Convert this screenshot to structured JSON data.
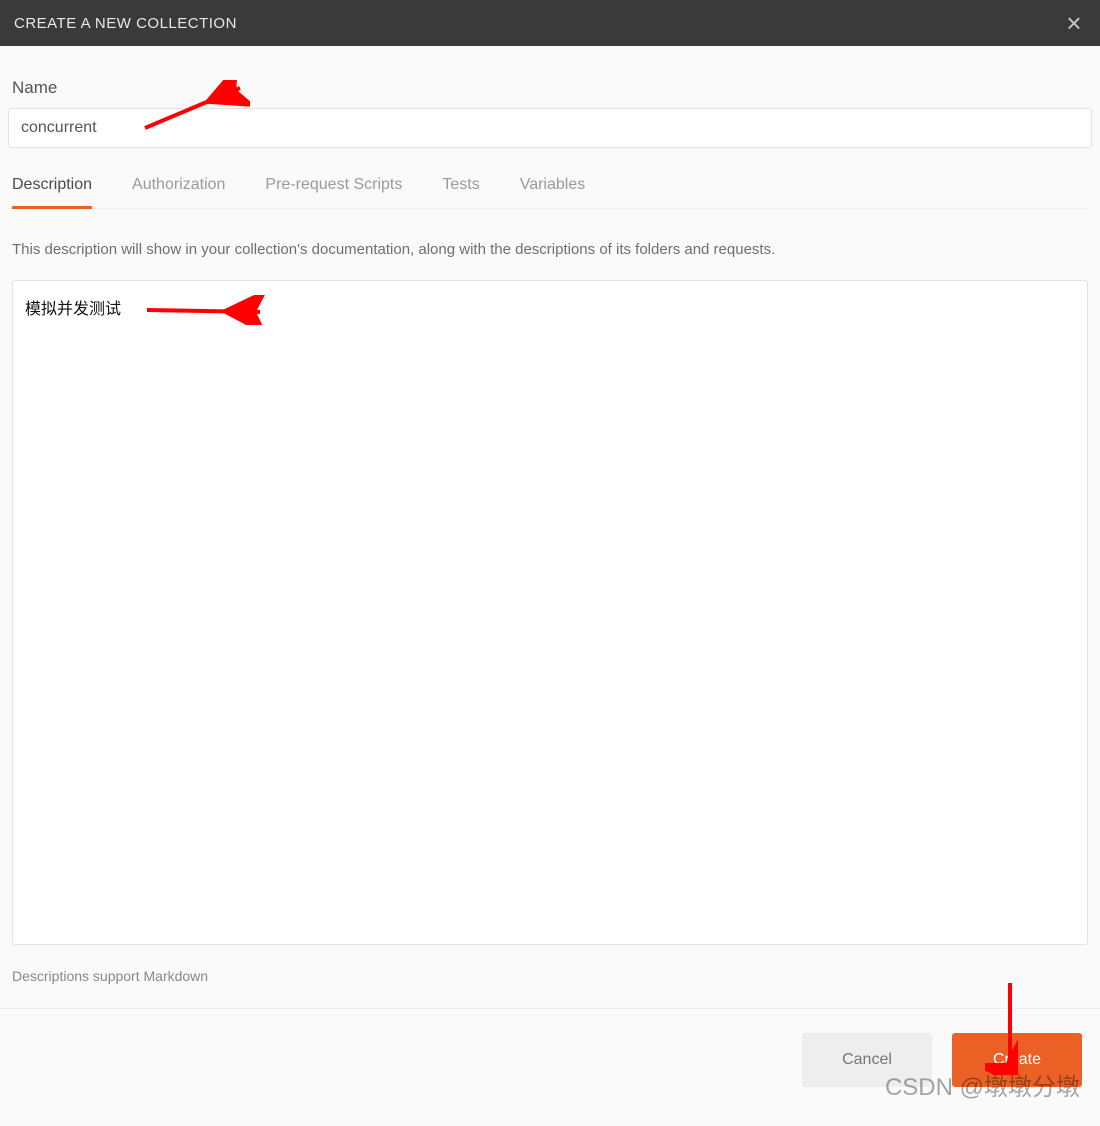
{
  "header": {
    "title": "CREATE A NEW COLLECTION"
  },
  "form": {
    "name_label": "Name",
    "name_value": "concurrent"
  },
  "tabs": {
    "items": [
      {
        "label": "Description",
        "active": true
      },
      {
        "label": "Authorization",
        "active": false
      },
      {
        "label": "Pre-request Scripts",
        "active": false
      },
      {
        "label": "Tests",
        "active": false
      },
      {
        "label": "Variables",
        "active": false
      }
    ],
    "description_hint": "This description will show in your collection's documentation, along with the descriptions of its folders and requests.",
    "description_value": "模拟并发测试",
    "markdown_note": "Descriptions support Markdown"
  },
  "footer": {
    "cancel_label": "Cancel",
    "create_label": "Create"
  },
  "watermark": "CSDN @墩墩分墩"
}
